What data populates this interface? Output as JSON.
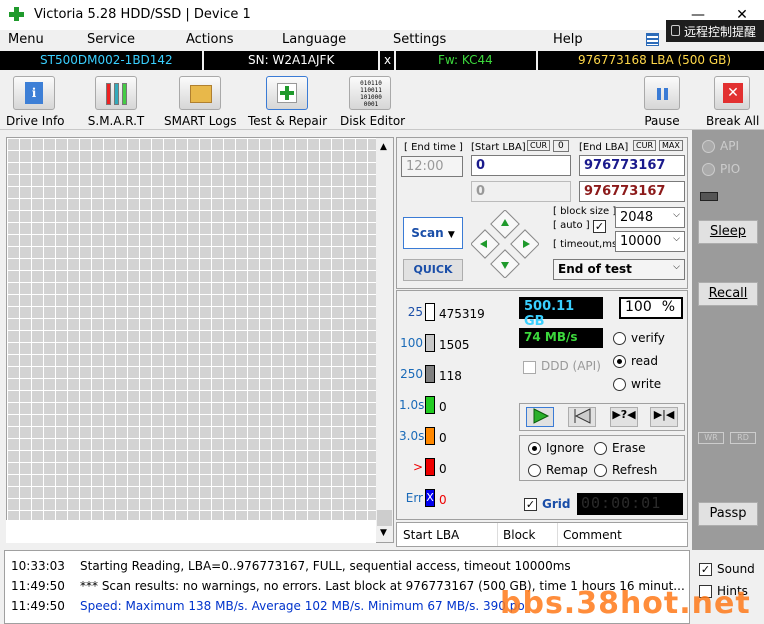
{
  "window": {
    "title": "Victoria 5.28 HDD/SSD | Device 1",
    "minimize": "—",
    "close": "✕"
  },
  "overlay": {
    "remote_text": "远程控制提醒"
  },
  "menu": [
    "Menu",
    "Service",
    "Actions",
    "Language",
    "Settings",
    "Help"
  ],
  "infobar": {
    "model": "ST500DM002-1BD142",
    "serial": "SN: W2A1AJFK",
    "x": "x",
    "firmware": "Fw: KC44",
    "lba": "976773168 LBA (500 GB)"
  },
  "toolbar": {
    "drive_info": "Drive Info",
    "smart": "S.M.A.R.T",
    "smart_logs": "SMART Logs",
    "test_repair": "Test & Repair",
    "disk_editor": "Disk Editor",
    "pause": "Pause",
    "break_all": "Break All",
    "disk_editor_text": "010110 110011 101000 0001"
  },
  "controls": {
    "end_time_label": "[ End time ]",
    "end_time": "12:00",
    "start_lba_label": "[Start LBA]",
    "cur": "CUR",
    "zero": "0",
    "end_lba_label": "[End LBA]",
    "cur2": "CUR",
    "max": "MAX",
    "start_lba": "0",
    "end_lba": "976773167",
    "start_lba2": "0",
    "end_lba2": "976773167",
    "block_size_label": "[ block size ]",
    "auto_label": "[ auto ]",
    "block_size": "2048",
    "timeout_label": "[ timeout,ms ]",
    "timeout": "10000",
    "scan": "Scan",
    "quick": "QUICK",
    "end_of_test": "End of test"
  },
  "stats": {
    "rows": [
      {
        "label": "25",
        "value": "475319",
        "color": "#ffffff"
      },
      {
        "label": "100",
        "value": "1505",
        "color": "#c8c8c8"
      },
      {
        "label": "250",
        "value": "118",
        "color": "#808080"
      },
      {
        "label": "1.0s",
        "value": "0",
        "color": "#22cc22"
      },
      {
        "label": "3.0s",
        "value": "0",
        "color": "#ff8800"
      },
      {
        "label": ">",
        "value": "0",
        "color": "#ee0000"
      },
      {
        "label": "Err",
        "value": "0",
        "color": "#0000ee",
        "mark": "X"
      }
    ],
    "size": "500.11 GB",
    "percent": "100",
    "percent_sign": "%",
    "speed": "74 MB/s",
    "ddd": "DDD (API)",
    "verify": "verify",
    "read": "read",
    "write": "write",
    "ignore": "Ignore",
    "erase": "Erase",
    "remap": "Remap",
    "refresh": "Refresh",
    "grid": "Grid",
    "timer": "00:00:01"
  },
  "right": {
    "api": "API",
    "pio": "PIO",
    "sleep": "Sleep",
    "recall": "Recall",
    "wr": "WR",
    "rd": "RD",
    "passp": "Passp",
    "sound": "Sound",
    "hints": "Hints"
  },
  "columns": [
    "Start LBA",
    "Block",
    "Comment"
  ],
  "log": [
    {
      "time": "10:33:03",
      "msg": "Starting Reading, LBA=0..976773167, FULL, sequential access, timeout 10000ms",
      "color": "#000000"
    },
    {
      "time": "11:49:50",
      "msg": "*** Scan results: no warnings, no errors. Last block at 976773167 (500 GB), time 1 hours 16 minut...",
      "color": "#000000"
    },
    {
      "time": "11:49:50",
      "msg": "Speed: Maximum 138 MB/s. Average 102 MB/s. Minimum 67 MB/s. 390 po",
      "color": "#0033cc"
    }
  ],
  "watermark": "bbs.38hot.net"
}
